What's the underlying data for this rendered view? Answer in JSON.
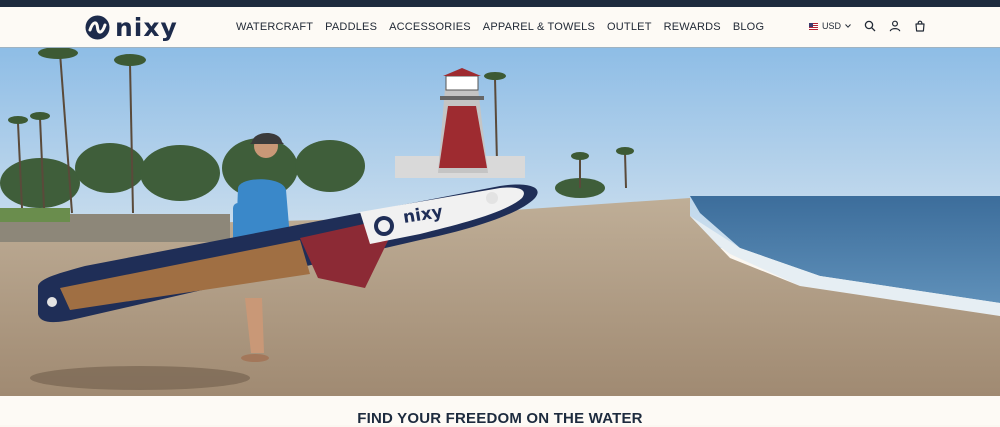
{
  "brand": {
    "name": "NIXY",
    "logo_text": "nixy"
  },
  "nav": {
    "items": [
      {
        "label": "WATERCRAFT"
      },
      {
        "label": "PADDLES"
      },
      {
        "label": "ACCESSORIES"
      },
      {
        "label": "APPAREL & TOWELS"
      },
      {
        "label": "OUTLET"
      },
      {
        "label": "REWARDS"
      },
      {
        "label": "BLOG"
      }
    ]
  },
  "utility": {
    "currency": "USD",
    "icons": [
      "us-flag-icon",
      "chevron-down-icon",
      "search-icon",
      "account-icon",
      "cart-icon"
    ]
  },
  "hero": {
    "board_brand": "nixy",
    "scene": "person carrying inflatable paddle board on beach"
  },
  "tagline": "FIND YOUR FREEDOM ON THE WATER",
  "colors": {
    "topbar": "#1d2b3e",
    "header_bg": "#fdfaf5",
    "brand_navy": "#1d2b4b",
    "board_red": "#8c2a35",
    "sky": "#a9c9e6",
    "sand": "#c9b49b",
    "ocean": "#4f7ea8"
  }
}
